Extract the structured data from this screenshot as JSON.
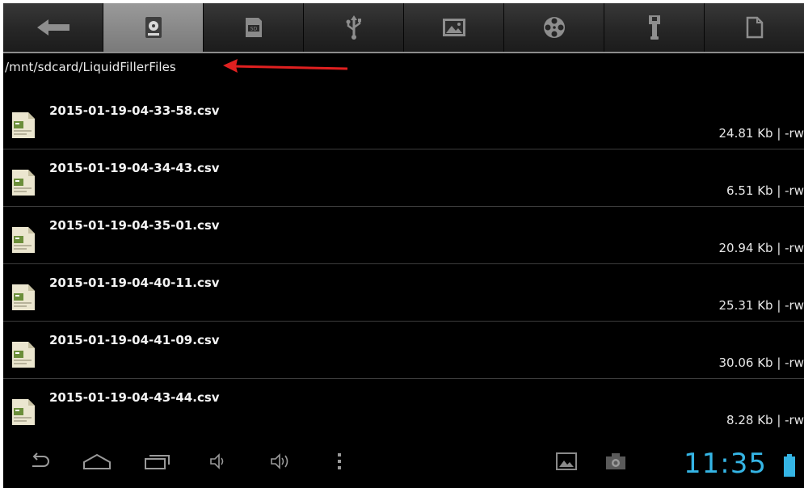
{
  "tabs": [
    {
      "icon": "back-arrow-icon"
    },
    {
      "icon": "internal-storage-icon",
      "active": true
    },
    {
      "icon": "sd-card-icon"
    },
    {
      "icon": "usb-icon"
    },
    {
      "icon": "picture-icon"
    },
    {
      "icon": "film-reel-icon"
    },
    {
      "icon": "wrench-icon"
    },
    {
      "icon": "document-icon"
    }
  ],
  "path": "/mnt/sdcard/LiquidFillerFiles",
  "files": [
    {
      "name": "2015-01-19-04-33-58.csv",
      "meta": "24.81 Kb | -rw"
    },
    {
      "name": "2015-01-19-04-34-43.csv",
      "meta": "6.51 Kb | -rw"
    },
    {
      "name": "2015-01-19-04-35-01.csv",
      "meta": "20.94 Kb | -rw"
    },
    {
      "name": "2015-01-19-04-40-11.csv",
      "meta": "25.31 Kb | -rw"
    },
    {
      "name": "2015-01-19-04-41-09.csv",
      "meta": "30.06 Kb | -rw"
    },
    {
      "name": "2015-01-19-04-43-44.csv",
      "meta": "8.28 Kb | -rw"
    }
  ],
  "system_bar": {
    "clock": "11:35",
    "accent_color": "#35b5e5",
    "annotation_color": "#e02020"
  }
}
